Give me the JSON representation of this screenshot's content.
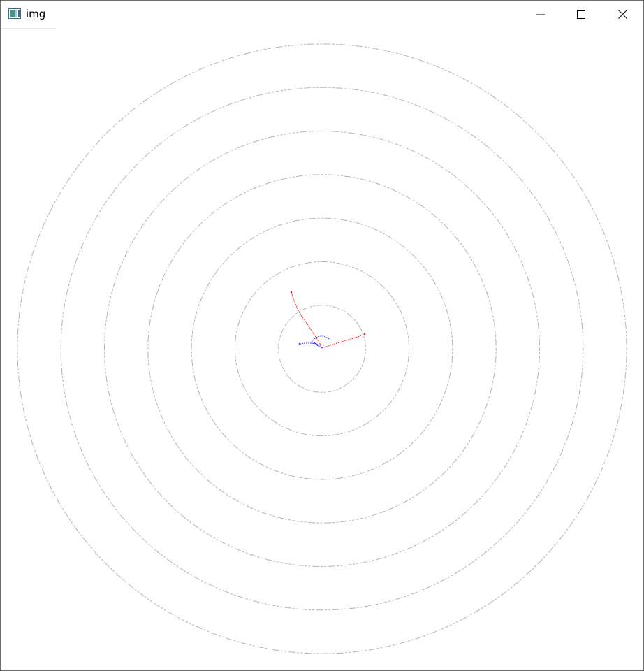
{
  "window": {
    "title": "img",
    "buttons": {
      "minimize_icon": "minimize-icon",
      "maximize_icon": "maximize-icon",
      "close_icon": "close-icon"
    }
  },
  "colors": {
    "ring": "#b4b4b4",
    "red_trace": "#ff2020",
    "blue_trace": "#3c3cff",
    "background": "#ffffff"
  },
  "canvas": {
    "ring_count": 7
  }
}
